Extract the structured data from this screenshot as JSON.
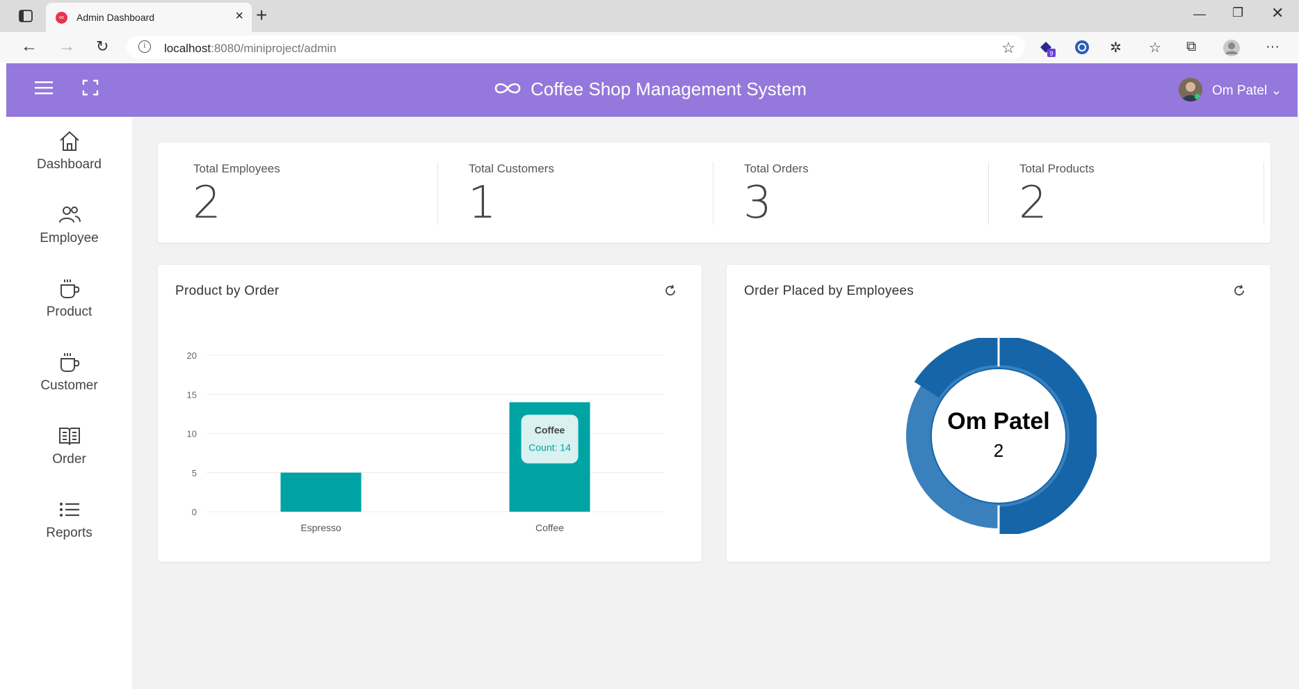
{
  "browser": {
    "tab_title": "Admin Dashboard",
    "url_host": "localhost",
    "url_path": ":8080/miniproject/admin",
    "extension_badge": "9"
  },
  "header": {
    "title": "Coffee Shop Management System",
    "user_name": "Om Patel ⌄",
    "bg_color": "#9478dc"
  },
  "sidebar": {
    "items": [
      {
        "label": "Dashboard",
        "icon": "home-icon"
      },
      {
        "label": "Employee",
        "icon": "users-icon"
      },
      {
        "label": "Product",
        "icon": "cup-icon"
      },
      {
        "label": "Customer",
        "icon": "cup-icon"
      },
      {
        "label": "Order",
        "icon": "book-icon"
      },
      {
        "label": "Reports",
        "icon": "list-icon"
      }
    ]
  },
  "stats": [
    {
      "label": "Total Employees",
      "value": "2"
    },
    {
      "label": "Total Customers",
      "value": "1"
    },
    {
      "label": "Total Orders",
      "value": "3"
    },
    {
      "label": "Total Products",
      "value": "2"
    }
  ],
  "bar_card": {
    "title": "Product by Order"
  },
  "donut_card": {
    "title": "Order Placed by Employees"
  },
  "chart_data": [
    {
      "type": "bar",
      "title": "Product by Order",
      "categories": [
        "Espresso",
        "Coffee"
      ],
      "values": [
        5,
        14
      ],
      "ylim": [
        0,
        20
      ],
      "yticks": [
        "0",
        "5",
        "10",
        "15",
        "20"
      ],
      "color": "#00a3a3",
      "grid": true,
      "tooltip": {
        "title": "Coffee",
        "text": "Count: 14"
      }
    },
    {
      "type": "pie",
      "title": "Order Placed by Employees",
      "labels": [
        "Om Patel"
      ],
      "values": [
        2
      ],
      "colors": [
        "#1565a8",
        "#3a80bd"
      ],
      "center_label": "Om Patel",
      "center_value": "2"
    }
  ]
}
